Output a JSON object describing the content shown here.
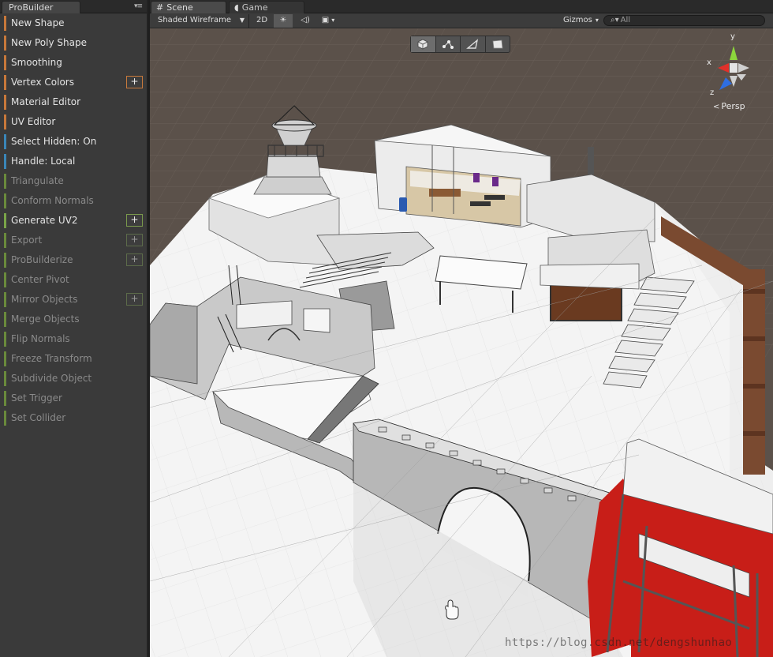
{
  "probuilder": {
    "tab_title": "ProBuilder",
    "items": [
      {
        "label": "New Shape",
        "color": "#c8783a",
        "dim": false,
        "plus": false
      },
      {
        "label": "New Poly Shape",
        "color": "#c8783a",
        "dim": false,
        "plus": false
      },
      {
        "label": "Smoothing",
        "color": "#c8783a",
        "dim": false,
        "plus": false
      },
      {
        "label": "Vertex Colors",
        "color": "#c8783a",
        "dim": false,
        "plus": true
      },
      {
        "label": "Material Editor",
        "color": "#c8783a",
        "dim": false,
        "plus": false
      },
      {
        "label": "UV Editor",
        "color": "#c8783a",
        "dim": false,
        "plus": false
      },
      {
        "label": "Select Hidden: On",
        "color": "#3a86b8",
        "dim": false,
        "plus": false
      },
      {
        "label": "Handle: Local",
        "color": "#3a86b8",
        "dim": false,
        "plus": false
      },
      {
        "label": "Triangulate",
        "color": "#6a8a3c",
        "dim": true,
        "plus": false
      },
      {
        "label": "Conform Normals",
        "color": "#6a8a3c",
        "dim": true,
        "plus": false
      },
      {
        "label": "Generate UV2",
        "color": "#7aa448",
        "dim": false,
        "plus": true
      },
      {
        "label": "Export",
        "color": "#6a8a3c",
        "dim": true,
        "plus": true
      },
      {
        "label": "ProBuilderize",
        "color": "#6a8a3c",
        "dim": true,
        "plus": true
      },
      {
        "label": "Center Pivot",
        "color": "#6a8a3c",
        "dim": true,
        "plus": false
      },
      {
        "label": "Mirror Objects",
        "color": "#6a8a3c",
        "dim": true,
        "plus": true
      },
      {
        "label": "Merge Objects",
        "color": "#6a8a3c",
        "dim": true,
        "plus": false
      },
      {
        "label": "Flip Normals",
        "color": "#6a8a3c",
        "dim": true,
        "plus": false
      },
      {
        "label": "Freeze Transform",
        "color": "#6a8a3c",
        "dim": true,
        "plus": false
      },
      {
        "label": "Subdivide Object",
        "color": "#6a8a3c",
        "dim": true,
        "plus": false
      },
      {
        "label": "Set Trigger",
        "color": "#6a8a3c",
        "dim": true,
        "plus": false
      },
      {
        "label": "Set Collider",
        "color": "#6a8a3c",
        "dim": true,
        "plus": false
      }
    ],
    "plus_label": "+"
  },
  "tabs": {
    "scene": "Scene",
    "game": "Game"
  },
  "toolbar": {
    "shading_mode": "Shaded Wireframe",
    "mode_2d": "2D",
    "gizmos": "Gizmos",
    "search_placeholder": "All"
  },
  "gizmo": {
    "axis_y": "y",
    "axis_x": "x",
    "axis_z": "z",
    "projection": "Persp",
    "colors": {
      "x": "#e0302a",
      "y": "#8cd63c",
      "z": "#2f6ee0"
    }
  },
  "watermark": "https://blog.csdn.net/dengshunhao"
}
